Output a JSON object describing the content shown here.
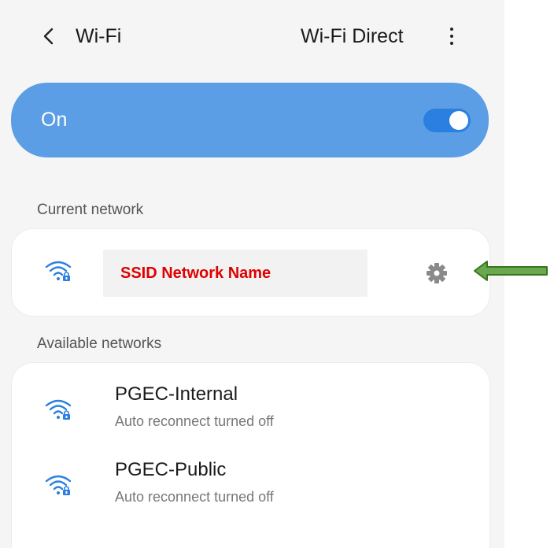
{
  "header": {
    "title": "Wi-Fi",
    "action": "Wi-Fi Direct"
  },
  "wifi_toggle": {
    "label": "On",
    "state": true
  },
  "current_network": {
    "section_label": "Current network",
    "ssid": "SSID Network Name"
  },
  "available_networks": {
    "section_label": "Available networks",
    "items": [
      {
        "name": "PGEC-Internal",
        "status": "Auto reconnect turned off"
      },
      {
        "name": "PGEC-Public",
        "status": "Auto reconnect turned off"
      }
    ]
  },
  "colors": {
    "toggle_card": "#5b9ee6",
    "ssid_text": "#e00000",
    "arrow": "#5e9c3a"
  }
}
